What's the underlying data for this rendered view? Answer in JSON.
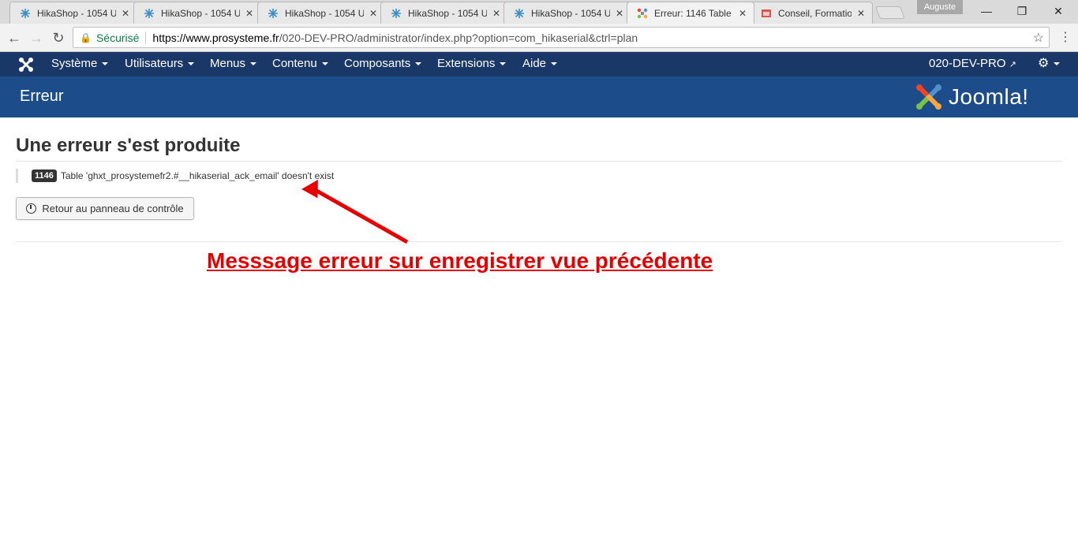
{
  "browser": {
    "tabs": [
      {
        "title": "HikaShop - 1054 U",
        "active": false
      },
      {
        "title": "HikaShop - 1054 U",
        "active": false
      },
      {
        "title": "HikaShop - 1054 U",
        "active": false
      },
      {
        "title": "HikaShop - 1054 U",
        "active": false
      },
      {
        "title": "HikaShop - 1054 U",
        "active": false
      },
      {
        "title": "Erreur: 1146 Table",
        "active": true
      },
      {
        "title": "Conseil, Formation",
        "active": false
      }
    ],
    "profile_name": "Auguste",
    "secure_label": "Sécurisé",
    "url_host": "https://www.prosysteme.fr",
    "url_path": "/020-DEV-PRO/administrator/index.php?option=com_hikaserial&ctrl=plan"
  },
  "joomla_nav": {
    "items": [
      "Système",
      "Utilisateurs",
      "Menus",
      "Contenu",
      "Composants",
      "Extensions",
      "Aide"
    ],
    "site_name": "020-DEV-PRO"
  },
  "header": {
    "page_title": "Erreur",
    "brand": "Joomla!"
  },
  "content": {
    "heading": "Une erreur s'est produite",
    "error_code": "1146",
    "error_message": "Table 'ghxt_prosystemefr2.#__hikaserial_ack_email' doesn't exist",
    "back_button": "Retour au panneau de contrôle"
  },
  "annotation": {
    "text": "Messsage erreur sur enregistrer vue précédente",
    "color": "#e60000"
  },
  "colors": {
    "nav_bg": "#1a3867",
    "header_bg": "#1c4d8a"
  }
}
